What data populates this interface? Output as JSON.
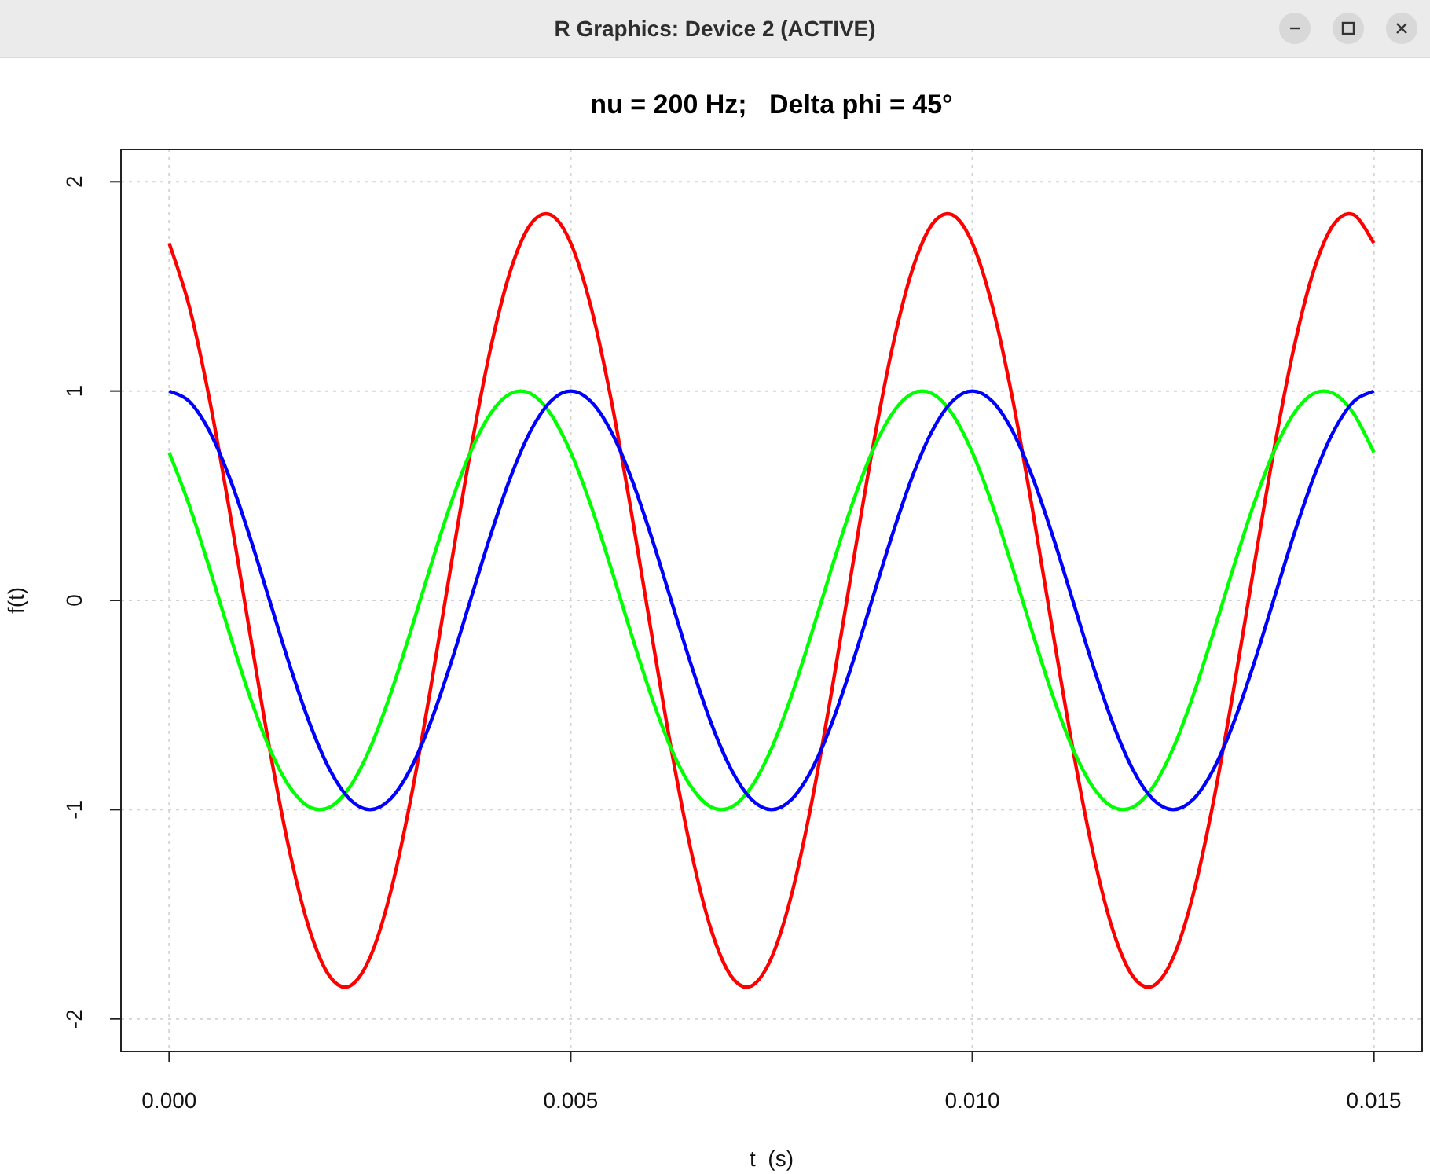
{
  "window": {
    "title": "R Graphics: Device 2 (ACTIVE)"
  },
  "plot": {
    "chart_data": {
      "type": "line",
      "title": "nu = 200 Hz;   Delta phi = 45°",
      "xlabel": "t  (s)",
      "ylabel": "f(t)",
      "x": [
        0,
        0.00025,
        0.0005,
        0.00075,
        0.001,
        0.00125,
        0.0015,
        0.00175,
        0.002,
        0.00225,
        0.0025,
        0.00275,
        0.003,
        0.00325,
        0.0035,
        0.00375,
        0.004,
        0.00425,
        0.0045,
        0.00475,
        0.005,
        0.00525,
        0.0055,
        0.00575,
        0.006,
        0.00625,
        0.0065,
        0.00675,
        0.007,
        0.00725,
        0.0075,
        0.00775,
        0.008,
        0.00825,
        0.0085,
        0.00875,
        0.009,
        0.00925,
        0.0095,
        0.00975,
        0.01,
        0.01025,
        0.0105,
        0.01075,
        0.011,
        0.01125,
        0.0115,
        0.01175,
        0.012,
        0.01225,
        0.0125,
        0.01275,
        0.013,
        0.01325,
        0.0135,
        0.01375,
        0.014,
        0.01425,
        0.0145,
        0.01475,
        0.015
      ],
      "series": [
        {
          "color": "#ff0000",
          "values": [
            1.707,
            1.405,
            0.965,
            0.432,
            -0.145,
            -0.707,
            -1.2,
            -1.576,
            -1.797,
            -1.842,
            -1.707,
            -1.405,
            -0.965,
            -0.432,
            0.145,
            0.707,
            1.2,
            1.576,
            1.797,
            1.842,
            1.707,
            1.405,
            0.965,
            0.432,
            -0.145,
            -0.707,
            -1.2,
            -1.576,
            -1.797,
            -1.842,
            -1.707,
            -1.405,
            -0.965,
            -0.432,
            0.145,
            0.707,
            1.2,
            1.576,
            1.797,
            1.842,
            1.707,
            1.405,
            0.965,
            0.432,
            -0.145,
            -0.707,
            -1.2,
            -1.576,
            -1.797,
            -1.842,
            -1.707,
            -1.405,
            -0.965,
            -0.432,
            0.145,
            0.707,
            1.2,
            1.576,
            1.797,
            1.842,
            1.707
          ]
        },
        {
          "color": "#00ff00",
          "values": [
            0.707,
            0.454,
            0.156,
            -0.156,
            -0.454,
            -0.707,
            -0.891,
            -0.988,
            -0.988,
            -0.891,
            -0.707,
            -0.454,
            -0.156,
            0.156,
            0.454,
            0.707,
            0.891,
            0.988,
            0.988,
            0.891,
            0.707,
            0.454,
            0.156,
            -0.156,
            -0.454,
            -0.707,
            -0.891,
            -0.988,
            -0.988,
            -0.891,
            -0.707,
            -0.454,
            -0.156,
            0.156,
            0.454,
            0.707,
            0.891,
            0.988,
            0.988,
            0.891,
            0.707,
            0.454,
            0.156,
            -0.156,
            -0.454,
            -0.707,
            -0.891,
            -0.988,
            -0.988,
            -0.891,
            -0.707,
            -0.454,
            -0.156,
            0.156,
            0.454,
            0.707,
            0.891,
            0.988,
            0.988,
            0.891,
            0.707
          ]
        },
        {
          "color": "#0000ff",
          "values": [
            1,
            0.951,
            0.809,
            0.588,
            0.309,
            0,
            -0.309,
            -0.588,
            -0.809,
            -0.951,
            -1,
            -0.951,
            -0.809,
            -0.588,
            -0.309,
            0,
            0.309,
            0.588,
            0.809,
            0.951,
            1,
            0.951,
            0.809,
            0.588,
            0.309,
            0,
            -0.309,
            -0.588,
            -0.809,
            -0.951,
            -1,
            -0.951,
            -0.809,
            -0.588,
            -0.309,
            0,
            0.309,
            0.588,
            0.809,
            0.951,
            1,
            0.951,
            0.809,
            0.588,
            0.309,
            0,
            -0.309,
            -0.588,
            -0.809,
            -0.951,
            -1,
            -0.951,
            -0.809,
            -0.588,
            -0.309,
            0,
            0.309,
            0.588,
            0.809,
            0.951,
            1
          ]
        }
      ],
      "grid": true,
      "xlim": [
        -0.0006,
        0.0156
      ],
      "ylim": [
        -2.155,
        2.155
      ],
      "xticks": [
        {
          "value": 0,
          "label": "0.000"
        },
        {
          "value": 0.005,
          "label": "0.005"
        },
        {
          "value": 0.01,
          "label": "0.010"
        },
        {
          "value": 0.015,
          "label": "0.015"
        }
      ],
      "yticks": [
        -2,
        -1,
        0,
        1,
        2
      ]
    }
  }
}
